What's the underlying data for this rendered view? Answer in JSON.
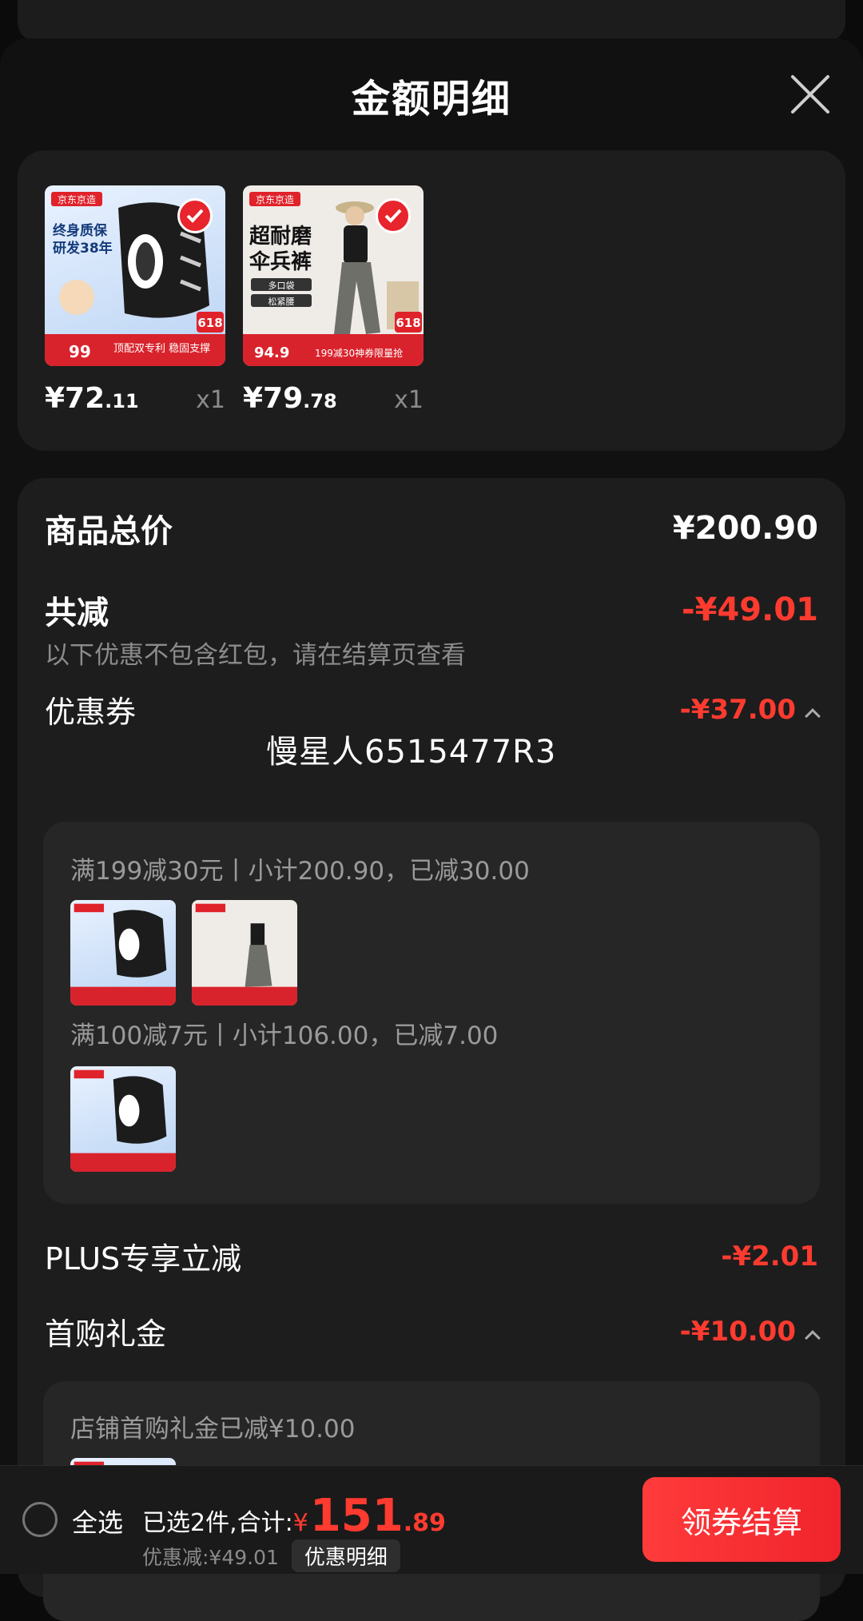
{
  "header": {
    "title": "金额明细"
  },
  "products": [
    {
      "price_int": "¥72",
      "price_dec": ".11",
      "qty": "x1",
      "tag": "京东京造",
      "line1": "终身质保",
      "line2": "研发38年",
      "badge": "618",
      "promo_price": "99",
      "promo_text": "顶配双专利 稳固支撑"
    },
    {
      "price_int": "¥79",
      "price_dec": ".78",
      "qty": "x1",
      "tag": "京东京造",
      "line1": "超耐磨",
      "line2": "伞兵裤",
      "chip1": "多口袋",
      "chip2": "松紧腰",
      "badge": "618",
      "promo_price": "94.9",
      "promo_text": "199减30神券限量抢"
    }
  ],
  "summary": {
    "goods_total_label": "商品总价",
    "goods_total_value": "¥200.90",
    "reduce_label": "共减",
    "reduce_value": "-¥49.01",
    "reduce_note": "以下优惠不包含红包，请在结算页查看"
  },
  "coupon": {
    "label": "优惠券",
    "value": "-¥37.00",
    "watermark": "慢星人6515477R3",
    "rule1": "满199减30元丨小计200.90，已减30.00",
    "rule2": "满100减7元丨小计106.00，已减7.00"
  },
  "plus": {
    "label": "PLUS专享立减",
    "value": "-¥2.01"
  },
  "first_buy": {
    "label": "首购礼金",
    "value": "-¥10.00",
    "note": "店铺首购礼金已减¥10.00"
  },
  "bottom": {
    "select_all": "全选",
    "selected_prefix": "已选2件,合计:",
    "currency": "¥",
    "total_int": "151",
    "total_dec": ".89",
    "discount": "优惠减:¥49.01",
    "detail_btn": "优惠明细",
    "checkout": "领券结算"
  },
  "colors": {
    "accent": "#ff3b30",
    "background": "#111111",
    "card": "#1d1d1d"
  }
}
